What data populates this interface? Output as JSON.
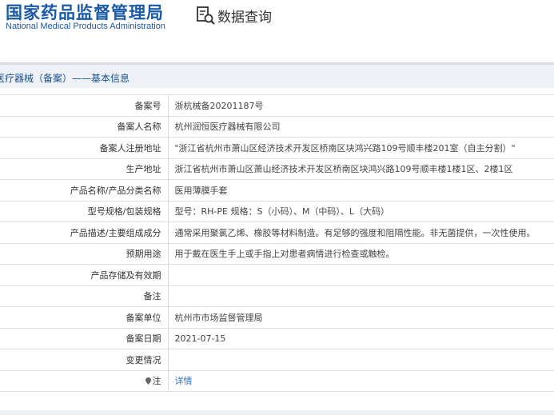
{
  "header": {
    "org_name_cn": "国家药品监督管理局",
    "org_name_en": "National Medical Products Administration",
    "query_label": "数据查询",
    "query_icon": "search-document-icon"
  },
  "section": {
    "title": "医疗器械（备案）——基本信息"
  },
  "rows": [
    {
      "label": "备案号",
      "value": "浙杭械备20201187号"
    },
    {
      "label": "备案人名称",
      "value": "杭州润恒医疗器械有限公司"
    },
    {
      "label": "备案人注册地址",
      "value": "\"浙江省杭州市萧山区经济技术开发区桥南区块鸿兴路109号顺丰楼201室（自主分割）\""
    },
    {
      "label": "生产地址",
      "value": "浙江省杭州市萧山区萧山经济技术开发区桥南区块鸿兴路109号顺丰楼1楼1区、2楼1区"
    },
    {
      "label": "产品名称/产品分类名称",
      "value": "医用薄膜手套"
    },
    {
      "label": "型号规格/包装规格",
      "value": "型号：RH-PE 规格：S（小码）、M（中码）、L（大码）"
    },
    {
      "label": "产品描述/主要组成成分",
      "value": "通常采用聚氯乙烯、橡胶等材料制造。有足够的强度和阻隔性能。非无菌提供，一次性使用。"
    },
    {
      "label": "预期用途",
      "value": "用于戴在医生手上或手指上对患者病情进行检查或触检。"
    },
    {
      "label": "产品存储及有效期",
      "value": ""
    },
    {
      "label": "备注",
      "value": ""
    },
    {
      "label": "备案单位",
      "value": "杭州市市场监督管理局"
    },
    {
      "label": "备案日期",
      "value": "2021-07-15"
    },
    {
      "label": "变更情况",
      "value": ""
    },
    {
      "label": "注",
      "value": "详情"
    }
  ],
  "colors": {
    "brand_blue": "#1a5aa6",
    "link_blue": "#2f72c4",
    "section_bg": "#eef1f5"
  }
}
